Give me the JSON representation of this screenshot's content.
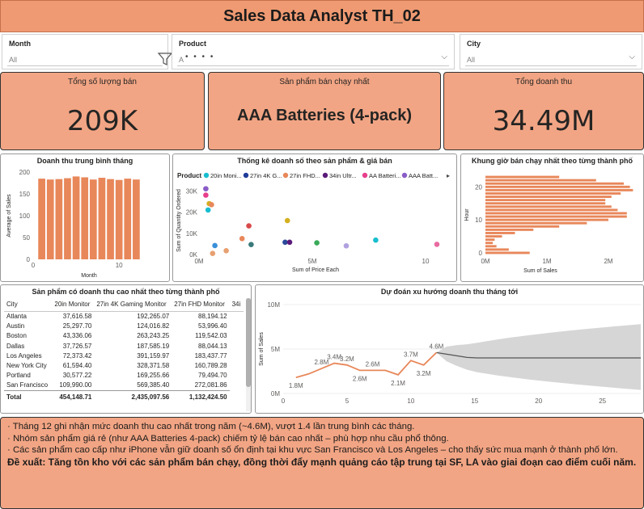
{
  "title": "Sales Data Analyst TH_02",
  "slicers": [
    {
      "label": "Month",
      "value": "All"
    },
    {
      "label": "Product",
      "value": "A"
    },
    {
      "label": "City",
      "value": "All"
    }
  ],
  "filter_icon": "filter-icon",
  "more_icon": "more-options-icon",
  "cards": [
    {
      "label": "Tổng số lượng bán",
      "value": "209K"
    },
    {
      "label": "Sản phẩm bán chạy nhất",
      "value": "AAA Batteries (4-pack)"
    },
    {
      "label": "Tổng doanh thu",
      "value": "34.49M"
    }
  ],
  "monthly_chart": {
    "title": "Doanh thu trung bình tháng",
    "xlabel": "Month",
    "ylabel": "Average of Sales",
    "chart_data": {
      "type": "bar",
      "x": [
        1,
        2,
        3,
        4,
        5,
        6,
        7,
        8,
        9,
        10,
        11,
        12
      ],
      "values": [
        185,
        183,
        184,
        186,
        190,
        188,
        183,
        187,
        184,
        182,
        185,
        183
      ],
      "yticks": [
        "0",
        "50",
        "100",
        "150",
        "200"
      ],
      "xticks": [
        "0",
        "10"
      ],
      "ylim": [
        0,
        200
      ],
      "color": "#e8875a"
    }
  },
  "scatter_chart": {
    "title": "Thống kê doanh số theo sản phẩm & giá bán",
    "legend_title": "Product",
    "legend": [
      {
        "name": "20in Moni...",
        "color": "#17becf"
      },
      {
        "name": "27in 4K G...",
        "color": "#1f3c9a"
      },
      {
        "name": "27in FHD...",
        "color": "#e8875a"
      },
      {
        "name": "34in Ultr...",
        "color": "#5a1a7a"
      },
      {
        "name": "AA Batteri...",
        "color": "#e83e8c"
      },
      {
        "name": "AAA Batt...",
        "color": "#8a5cc7"
      }
    ],
    "xlabel": "Sum of Price Each",
    "ylabel": "Sum of Quantity Ordered",
    "yticks": [
      "0K",
      "10K",
      "20K",
      "30K"
    ],
    "xticks": [
      "0M",
      "5M",
      "10"
    ],
    "chart_data": {
      "type": "scatter",
      "xlim": [
        0,
        11
      ],
      "ylim": [
        0,
        32000
      ],
      "points": [
        {
          "x": 0.3,
          "y": 31000,
          "color": "#8a5cc7"
        },
        {
          "x": 0.3,
          "y": 28000,
          "color": "#e83e8c"
        },
        {
          "x": 0.45,
          "y": 24000,
          "color": "#d4b020"
        },
        {
          "x": 0.55,
          "y": 23500,
          "color": "#e8875a"
        },
        {
          "x": 0.4,
          "y": 21000,
          "color": "#17becf"
        },
        {
          "x": 0.6,
          "y": 500,
          "color": "#e8a070"
        },
        {
          "x": 0.7,
          "y": 4200,
          "color": "#3b8fd9"
        },
        {
          "x": 1.2,
          "y": 1800,
          "color": "#e8a070"
        },
        {
          "x": 1.9,
          "y": 7500,
          "color": "#e8875a"
        },
        {
          "x": 2.3,
          "y": 4700,
          "color": "#3a7a7a"
        },
        {
          "x": 2.2,
          "y": 13500,
          "color": "#d94a4a"
        },
        {
          "x": 3.9,
          "y": 16000,
          "color": "#d4b020"
        },
        {
          "x": 3.8,
          "y": 5800,
          "color": "#2a4a9a"
        },
        {
          "x": 4.0,
          "y": 5800,
          "color": "#5a1a7a"
        },
        {
          "x": 5.2,
          "y": 5500,
          "color": "#3aaa5a"
        },
        {
          "x": 6.5,
          "y": 4100,
          "color": "#b0a0e0"
        },
        {
          "x": 7.8,
          "y": 6800,
          "color": "#17becf"
        },
        {
          "x": 10.5,
          "y": 4800,
          "color": "#e86aa0"
        }
      ]
    }
  },
  "hour_chart": {
    "title": "Khung giờ bán chạy nhất theo từng thành phố",
    "xlabel": "Sum of Sales",
    "ylabel": "Hour",
    "yticks": [
      "0",
      "10",
      "20"
    ],
    "xticks": [
      "0M",
      "1M",
      "2M"
    ],
    "chart_data": {
      "type": "bar",
      "orientation": "horizontal",
      "hours": [
        0,
        1,
        2,
        3,
        4,
        5,
        6,
        7,
        8,
        9,
        10,
        11,
        12,
        13,
        14,
        15,
        16,
        17,
        18,
        19,
        20,
        21,
        22,
        23
      ],
      "values_millions": [
        0.72,
        0.38,
        0.18,
        0.12,
        0.15,
        0.27,
        0.48,
        0.78,
        1.2,
        1.65,
        2.0,
        2.3,
        2.3,
        2.15,
        2.05,
        1.95,
        1.95,
        2.05,
        2.2,
        2.4,
        2.35,
        2.25,
        1.8,
        1.2
      ],
      "xlim": [
        0,
        2.5
      ],
      "color": "#e8875a"
    }
  },
  "city_table": {
    "title": "Sản phẩm có doanh thu cao nhất theo từng thành phố",
    "columns": [
      "City",
      "20in Monitor",
      "27in 4K Gaming Monitor",
      "27in FHD Monitor",
      "34i"
    ],
    "rows": [
      [
        "Atlanta",
        "37,616.58",
        "192,265.07",
        "88,194.12"
      ],
      [
        "Austin",
        "25,297.70",
        "124,016.82",
        "53,996.40"
      ],
      [
        "Boston",
        "43,336.06",
        "263,243.25",
        "119,542.03"
      ],
      [
        "Dallas",
        "37,726.57",
        "187,585.19",
        "88,044.13"
      ],
      [
        "Los Angeles",
        "72,373.42",
        "391,159.97",
        "183,437.77"
      ],
      [
        "New York City",
        "61,594.40",
        "328,371.58",
        "160,789.28"
      ],
      [
        "Portland",
        "30,577.22",
        "169,255.66",
        "79,494.70"
      ],
      [
        "San Francisco",
        "109,990.00",
        "569,385.40",
        "272,081.86"
      ]
    ],
    "total": [
      "Total",
      "454,148.71",
      "2,435,097.56",
      "1,132,424.50"
    ]
  },
  "forecast_chart": {
    "title": "Dự đoán xu hướng doanh thu tháng tới",
    "ylabel": "Sum of Sales",
    "yticks": [
      "0M",
      "5M",
      "10M"
    ],
    "xticks": [
      "0",
      "5",
      "10",
      "15",
      "20",
      "25"
    ],
    "chart_data": {
      "type": "line",
      "x": [
        1,
        2,
        3,
        4,
        5,
        6,
        7,
        8,
        9,
        10,
        11,
        12
      ],
      "y": [
        1.8,
        2.2,
        2.8,
        3.4,
        3.2,
        2.6,
        2.6,
        2.6,
        2.1,
        3.7,
        3.2,
        4.6
      ],
      "labels": [
        "1.8M",
        "",
        "2.8M",
        "3.4M",
        "3.2M",
        "2.6M",
        "2.6M",
        "",
        "2.1M",
        "3.7M",
        "3.2M",
        "4.6M"
      ],
      "forecast_start": 12,
      "forecast_end": 28,
      "forecast_value": 4.0,
      "band_low_end": 0.4,
      "band_high_end": 7.8,
      "xlim": [
        0,
        28
      ],
      "ylim": [
        0,
        10
      ],
      "line_color": "#e8875a",
      "forecast_color": "#555555",
      "band_color": "#d6d6d6"
    }
  },
  "notes": {
    "line1": "· Tháng 12 ghi nhận mức doanh thu cao nhất trong năm (~4.6M), vượt 1.4 lần trung bình các tháng.",
    "line2": "· Nhóm sản phẩm giá rẻ (như AAA Batteries 4-pack) chiếm tỷ lệ bán cao nhất – phù hợp nhu cầu phổ thông.",
    "line3": "· Các sản phẩm cao cấp như iPhone vẫn giữ doanh số ổn định tại khu vực San Francisco và Los Angeles – cho thấy sức mua mạnh ở thành phố lớn.",
    "line4": "Đề xuất: Tăng tồn kho với các sản phẩm bán chạy, đồng thời đẩy mạnh quảng cáo tập trung tại SF, LA vào giai đoạn cao điểm cuối năm."
  }
}
